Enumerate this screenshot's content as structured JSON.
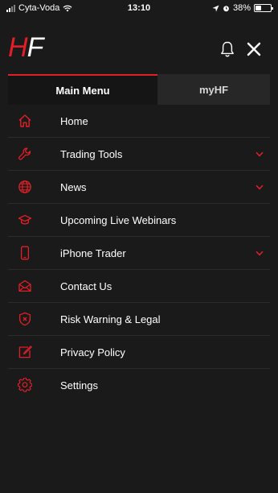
{
  "status_bar": {
    "carrier": "Cyta-Voda",
    "time": "13:10",
    "battery_text": "38%",
    "battery_level": 0.38
  },
  "header": {
    "logo_h": "H",
    "logo_f": "F",
    "bell_icon": "bell-icon",
    "close_icon": "close-icon"
  },
  "tabs": [
    {
      "label": "Main Menu",
      "active": true
    },
    {
      "label": "myHF",
      "active": false
    }
  ],
  "menu": {
    "items": [
      {
        "label": "Home",
        "icon": "home-icon",
        "has_submenu": false
      },
      {
        "label": "Trading Tools",
        "icon": "wrench-icon",
        "has_submenu": true
      },
      {
        "label": "News",
        "icon": "globe-icon",
        "has_submenu": true
      },
      {
        "label": "Upcoming Live Webinars",
        "icon": "graduation-cap-icon",
        "has_submenu": false
      },
      {
        "label": "iPhone Trader",
        "icon": "phone-icon",
        "has_submenu": true
      },
      {
        "label": "Contact Us",
        "icon": "envelope-icon",
        "has_submenu": false
      },
      {
        "label": "Risk Warning & Legal",
        "icon": "shield-icon",
        "has_submenu": false
      },
      {
        "label": "Privacy Policy",
        "icon": "edit-icon",
        "has_submenu": false
      },
      {
        "label": "Settings",
        "icon": "gear-icon",
        "has_submenu": false
      }
    ]
  },
  "colors": {
    "accent": "#e21f26",
    "background": "#1a1a1a",
    "tab_inactive": "#272727"
  }
}
